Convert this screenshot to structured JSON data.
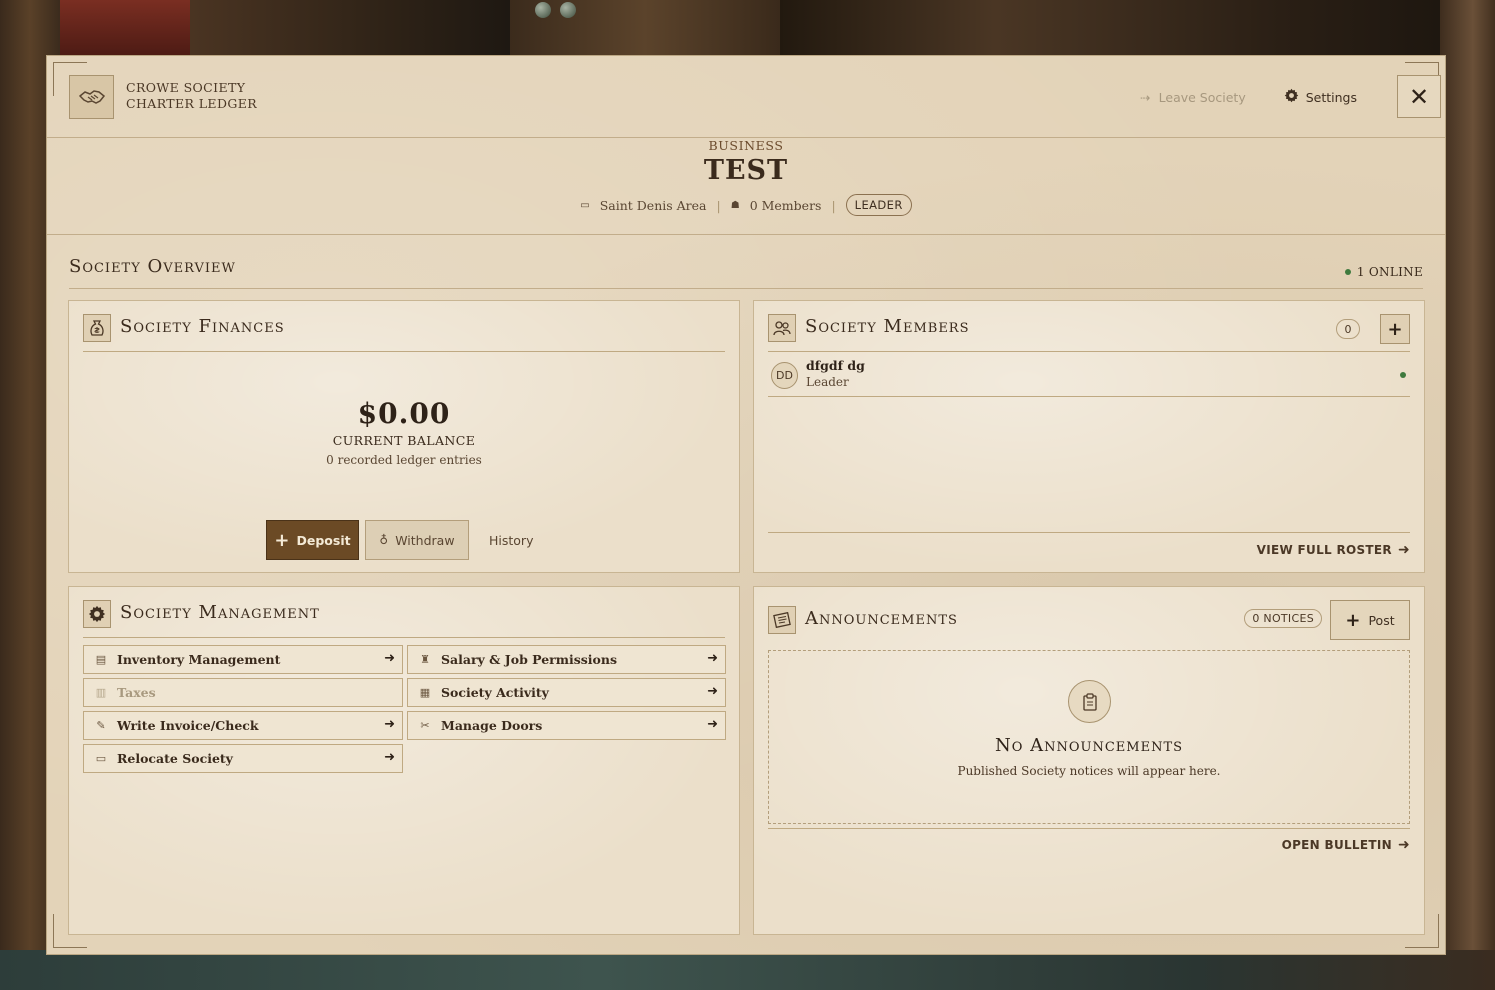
{
  "header": {
    "brand_icon": "handshake-icon",
    "brand_line1": "CROWE SOCIETY",
    "brand_line2": "CHARTER LEDGER",
    "leave_label": "Leave Society",
    "settings_label": "Settings",
    "close_symbol": "✕"
  },
  "society": {
    "type": "BUSINESS",
    "name": "TEST",
    "location": "Saint Denis Area",
    "members_text": "0 Members",
    "role": "LEADER"
  },
  "overview": {
    "title": "Society Overview",
    "online_text": "1 ONLINE"
  },
  "finances": {
    "title": "Society Finances",
    "balance": "$0.00",
    "balance_label": "CURRENT BALANCE",
    "ledger_text": "0 recorded ledger entries",
    "deposit_label": "Deposit",
    "withdraw_label": "Withdraw",
    "history_label": "History"
  },
  "members": {
    "title": "Society Members",
    "count": "0",
    "add_symbol": "+",
    "list": [
      {
        "initials": "DD",
        "name": "dfgdf dg",
        "role": "Leader",
        "online": true
      }
    ],
    "view_roster_label": "VIEW FULL ROSTER"
  },
  "management": {
    "title": "Society Management",
    "items": [
      {
        "label": "Inventory Management",
        "icon": "ledger-icon",
        "enabled": true
      },
      {
        "label": "Salary & Job Permissions",
        "icon": "badge-icon",
        "enabled": true
      },
      {
        "label": "Taxes",
        "icon": "bank-icon",
        "enabled": false
      },
      {
        "label": "Society Activity",
        "icon": "clipboard-icon",
        "enabled": true
      },
      {
        "label": "Write Invoice/Check",
        "icon": "invoice-icon",
        "enabled": true
      },
      {
        "label": "Manage Doors",
        "icon": "tools-icon",
        "enabled": true
      },
      {
        "label": "Relocate Society",
        "icon": "map-icon",
        "enabled": true
      }
    ]
  },
  "announcements": {
    "title": "Announcements",
    "notices_text": "0 NOTICES",
    "post_label": "Post",
    "empty_title": "No Announcements",
    "empty_sub": "Published Society notices will appear here.",
    "open_bulletin_label": "OPEN BULLETIN"
  },
  "colors": {
    "parchment": "#e3d3b8",
    "card": "#ebdfca",
    "accent_brown": "#6b4a25",
    "online_green": "#3f7a3e"
  }
}
